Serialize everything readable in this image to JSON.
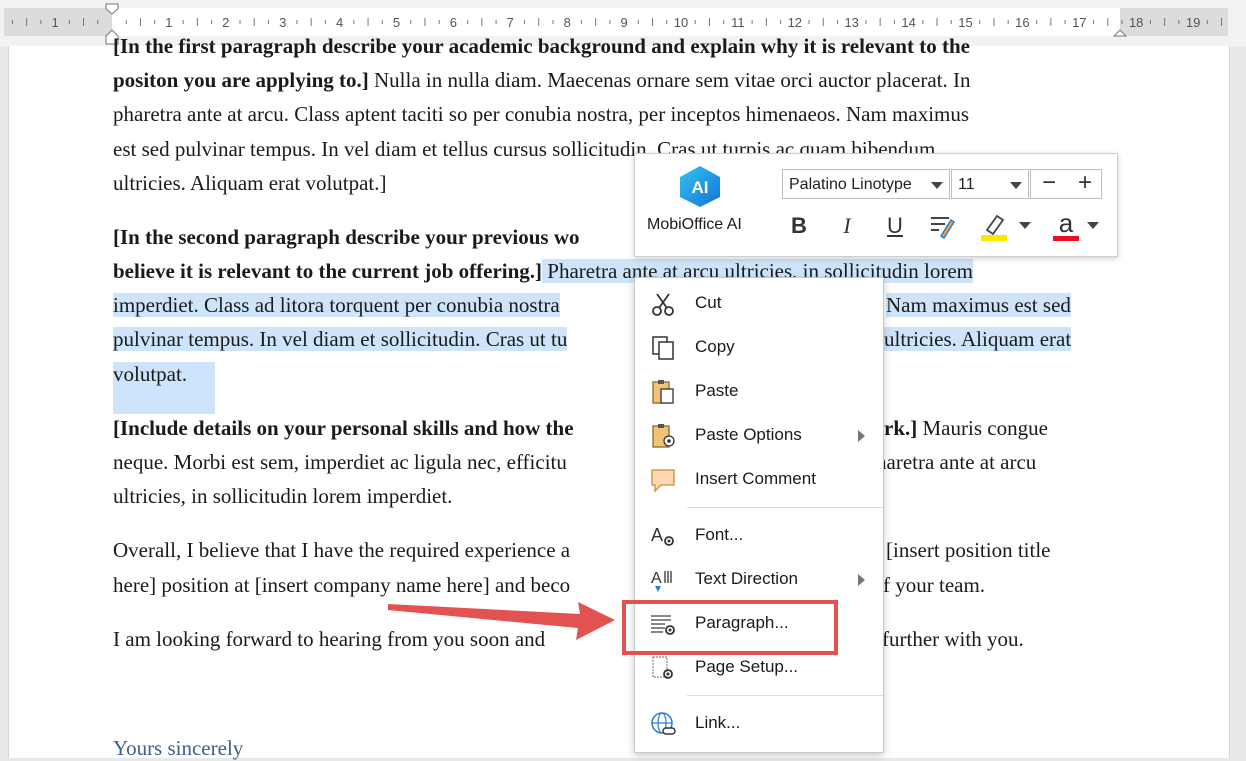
{
  "ruler": {
    "numbers": [
      "1",
      "1",
      "2",
      "3",
      "4",
      "5",
      "6",
      "7",
      "8",
      "9",
      "10",
      "11",
      "12",
      "13",
      "14",
      "15",
      "16",
      "17",
      "18",
      "19"
    ]
  },
  "document": {
    "p1_line0": "[In the first paragraph describe your academic background and explain why it is relevant to the",
    "p1_line1_bold": "positon you are applying to.]",
    "p1_line1_rest": "  Nulla in nulla diam. Maecenas ornare sem vitae orci auctor placerat. In",
    "p1_line2": "pharetra ante at arcu. Class aptent taciti so per conubia nostra, per inceptos himenaeos. Nam maximus",
    "p1_line3": "est sed pulvinar tempus. In vel diam et tellus cursus sollicitudin. Cras ut turpis ac quam bibendum",
    "p1_line4": "ultricies. Aliquam erat volutpat.]",
    "p2_line0_bold": "[In the second paragraph describe your previous wo",
    "p2_line1_bold": "believe it is relevant to the current job offering.]",
    "p2_line1_sel_a": " Pharetra ante at arcu ultricies, in sollicitudin lorem",
    "p2_line2_sel_a": "imperdiet. Class ad litora torquent per conubia nostra",
    "p2_line2_sel_b": "Nam maximus est sed",
    "p2_line3_sel_a": "pulvinar tempus. In vel diam et sollicitudin. Cras ut tu",
    "p2_line3_sel_b": "ultricies. Aliquam erat",
    "p2_line4_sel": "volutpat.",
    "p3_line0_bold": "[Include details on your personal skills and how the",
    "p3_line0_bold_b": "rk.]",
    "p3_line0_rest": " Mauris congue",
    "p3_line1_a": "neque. Morbi est sem, imperdiet ac ligula nec, efficitu",
    "p3_line1_b": "haretra ante at arcu",
    "p3_line2": "ultricies, in sollicitudin lorem imperdiet.",
    "p4_line0_a": "Overall, I believe that I have the required experience a",
    "p4_line0_b": "[insert position title",
    "p4_line1_a": "here] position at [insert company name here] and beco",
    "p4_line1_b": "f your team.",
    "p5_line0_a": "I am looking forward to hearing from you soon and",
    "p5_line0_b": "further with you.",
    "closing": "Yours sincerely"
  },
  "toolbar": {
    "ai_badge": "AI",
    "ai_label": "MobiOffice AI",
    "font_name": "Palatino Linotype",
    "font_size": "11",
    "decrease": "−",
    "increase": "+",
    "bold": "B",
    "italic": "I",
    "underline": "U",
    "font_color_glyph": "a",
    "highlight_color": "#ffe600",
    "font_color": "#e81123"
  },
  "context_menu": {
    "items": [
      {
        "label": "Cut",
        "icon": "scissors-icon"
      },
      {
        "label": "Copy",
        "icon": "copy-icon"
      },
      {
        "label": "Paste",
        "icon": "paste-icon"
      },
      {
        "label": "Paste Options",
        "icon": "paste-options-icon",
        "submenu": true
      },
      {
        "label": "Insert Comment",
        "icon": "comment-icon"
      },
      {
        "label": "Font...",
        "icon": "font-settings-icon"
      },
      {
        "label": "Text Direction",
        "icon": "text-direction-icon",
        "submenu": true
      },
      {
        "label": "Paragraph...",
        "icon": "paragraph-settings-icon"
      },
      {
        "label": "Page Setup...",
        "icon": "page-setup-icon"
      },
      {
        "label": "Link...",
        "icon": "link-icon"
      }
    ]
  },
  "annotation": {
    "highlight_color": "#e45151"
  }
}
